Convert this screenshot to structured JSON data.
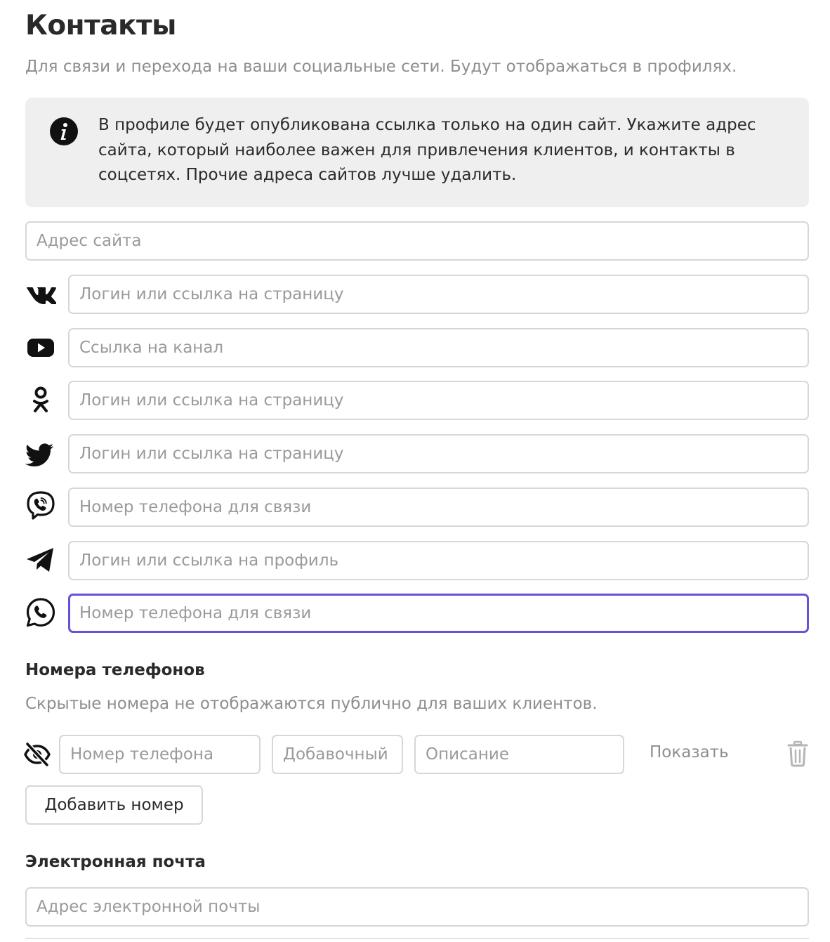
{
  "header": {
    "title": "Контакты",
    "subtitle": "Для связи и перехода на ваши социальные сети. Будут отображаться в профилях."
  },
  "notice": {
    "icon": "info-icon",
    "text": "В профиле будет опубликована ссылка только на один сайт. Укажите адрес сайта, который наиболее важен для привлечения клиентов, и контакты в соцсетях. Прочие адреса сайтов лучше удалить."
  },
  "website": {
    "placeholder": "Адрес сайта",
    "value": ""
  },
  "socials": [
    {
      "icon": "vk-icon",
      "placeholder": "Логин или ссылка на страницу",
      "value": ""
    },
    {
      "icon": "youtube-icon",
      "placeholder": "Ссылка на канал",
      "value": ""
    },
    {
      "icon": "odnoklassniki-icon",
      "placeholder": "Логин или ссылка на страницу",
      "value": ""
    },
    {
      "icon": "twitter-icon",
      "placeholder": "Логин или ссылка на страницу",
      "value": ""
    },
    {
      "icon": "viber-icon",
      "placeholder": "Номер телефона для связи",
      "value": ""
    },
    {
      "icon": "telegram-icon",
      "placeholder": "Логин или ссылка на профиль",
      "value": ""
    },
    {
      "icon": "whatsapp-icon",
      "placeholder": "Номер телефона для связи",
      "value": "",
      "focused": true
    }
  ],
  "phones": {
    "title": "Номера телефонов",
    "hint": "Скрытые номера не отображаются публично для ваших клиентов.",
    "row": {
      "visibility_icon": "eye-off-icon",
      "phone_placeholder": "Номер телефона",
      "extension_placeholder": "Добавочный",
      "description_placeholder": "Описание",
      "show_label": "Показать",
      "delete_icon": "trash-icon"
    },
    "add_button": "Добавить номер"
  },
  "email": {
    "title": "Электронная почта",
    "placeholder": "Адрес электронной почты",
    "value": ""
  },
  "colors": {
    "focus_border": "#6a50d8",
    "field_border": "#d7d7d7",
    "notice_bg": "#efefef",
    "muted_text": "#8e8e8e"
  }
}
